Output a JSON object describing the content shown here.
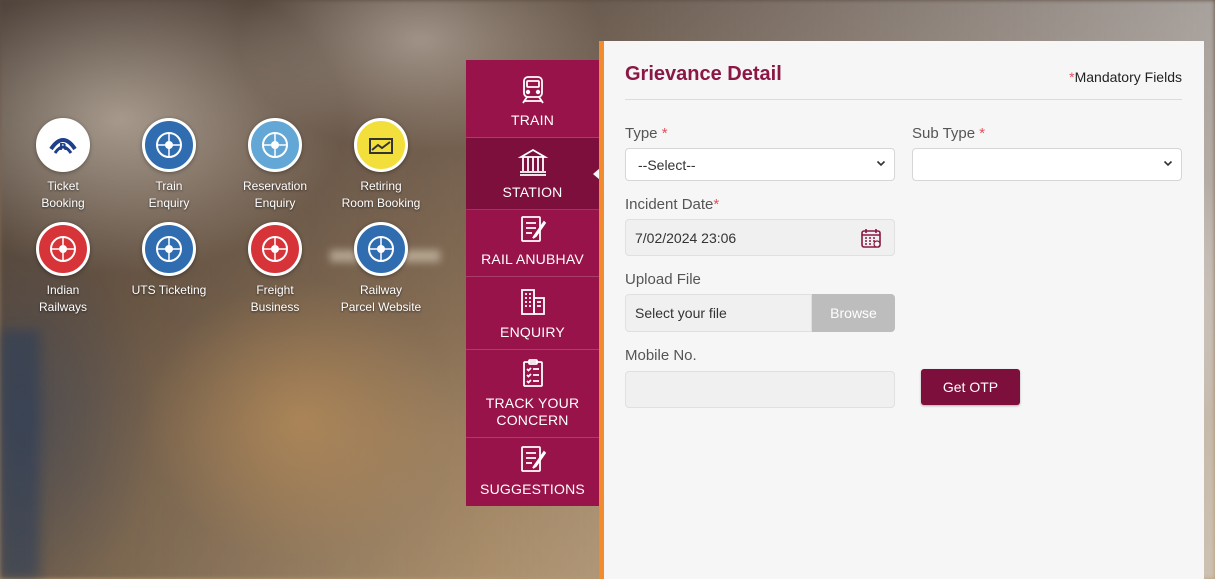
{
  "quick_links": [
    {
      "label_1": "Ticket",
      "label_2": "Booking",
      "icon": "irctc-logo-icon",
      "bg": "#ffffff",
      "inner": "#1f3f8a"
    },
    {
      "label_1": "Train",
      "label_2": "Enquiry",
      "icon": "indian-railways-blue-emblem-icon",
      "bg": "#2f6db0",
      "inner": "#1f4f8a"
    },
    {
      "label_1": "Reservation",
      "label_2": "Enquiry",
      "icon": "indian-railways-lightblue-emblem-icon",
      "bg": "#63a7d6",
      "inner": "#3f87bd"
    },
    {
      "label_1": "Retiring",
      "label_2": "Room Booking",
      "icon": "bed-icon",
      "bg": "#f2df3b",
      "inner": "#f2df3b"
    },
    {
      "label_1": "Indian",
      "label_2": "Railways",
      "icon": "indian-railways-red-emblem-icon",
      "bg": "#d7343a",
      "inner": "#b8222a"
    },
    {
      "label_1": "UTS Ticketing",
      "label_2": "",
      "icon": "indian-railways-blue-emblem-icon",
      "bg": "#2f6db0",
      "inner": "#1f4f8a"
    },
    {
      "label_1": "Freight",
      "label_2": "Business",
      "icon": "indian-railways-red-emblem-icon",
      "bg": "#d7343a",
      "inner": "#b8222a"
    },
    {
      "label_1": "Railway",
      "label_2": "Parcel Website",
      "icon": "indian-railways-blue-emblem-icon",
      "bg": "#2f6db0",
      "inner": "#1f4f8a"
    }
  ],
  "categories": [
    {
      "label": "TRAIN",
      "icon": "train-icon",
      "active": false
    },
    {
      "label": "STATION",
      "icon": "station-building-icon",
      "active": true
    },
    {
      "label": "RAIL ANUBHAV",
      "icon": "edit-note-icon",
      "active": false
    },
    {
      "label": "ENQUIRY",
      "icon": "buildings-icon",
      "active": false
    },
    {
      "label": "TRACK YOUR CONCERN",
      "icon": "checklist-icon",
      "active": false
    },
    {
      "label": "SUGGESTIONS",
      "icon": "edit-note-icon",
      "active": false
    }
  ],
  "form": {
    "title": "Grievance Detail",
    "mandatory_star": "*",
    "mandatory_text": "Mandatory Fields",
    "type_label": "Type",
    "type_value": "--Select--",
    "subtype_label": "Sub Type",
    "subtype_value": "",
    "required_mark": "*",
    "incident_label": "Incident Date",
    "incident_value": "7/02/2024 23:06",
    "upload_label": "Upload File",
    "upload_placeholder": "Select your file",
    "browse_label": "Browse",
    "mobile_label": "Mobile No.",
    "mobile_value": "",
    "otp_label": "Get OTP"
  },
  "colors": {
    "brand": "#981349",
    "brand_dark": "#7d0f3c",
    "accent": "#f28a2e",
    "title": "#8a1744",
    "required": "#e0505b"
  }
}
